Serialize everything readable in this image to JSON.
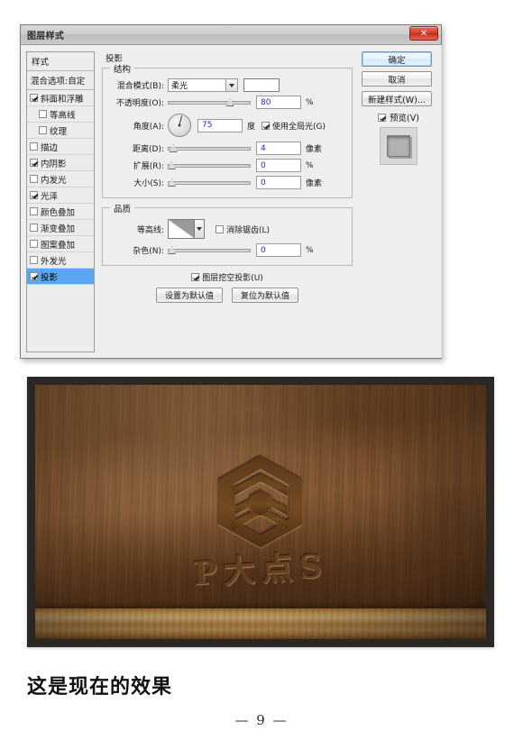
{
  "dialog": {
    "title": "图层样式",
    "close_label": "✕",
    "styles_panel": {
      "header": "样式",
      "blending_options": "混合选项:自定",
      "items": [
        {
          "label": "斜面和浮雕",
          "checked": true,
          "indent": false,
          "selected": false
        },
        {
          "label": "等高线",
          "checked": false,
          "indent": true,
          "selected": false
        },
        {
          "label": "纹理",
          "checked": false,
          "indent": true,
          "selected": false
        },
        {
          "label": "描边",
          "checked": false,
          "indent": false,
          "selected": false
        },
        {
          "label": "内阴影",
          "checked": true,
          "indent": false,
          "selected": false
        },
        {
          "label": "内发光",
          "checked": false,
          "indent": false,
          "selected": false
        },
        {
          "label": "光泽",
          "checked": true,
          "indent": false,
          "selected": false
        },
        {
          "label": "颜色叠加",
          "checked": false,
          "indent": false,
          "selected": false
        },
        {
          "label": "渐变叠加",
          "checked": false,
          "indent": false,
          "selected": false
        },
        {
          "label": "图案叠加",
          "checked": false,
          "indent": false,
          "selected": false
        },
        {
          "label": "外发光",
          "checked": false,
          "indent": false,
          "selected": false
        },
        {
          "label": "投影",
          "checked": true,
          "indent": false,
          "selected": true
        }
      ]
    },
    "drop_shadow": {
      "panel_title": "投影",
      "structure": {
        "legend": "结构",
        "blend_mode_label": "混合模式(B):",
        "blend_mode_value": "柔光",
        "color_swatch": "#ffffff",
        "opacity_label": "不透明度(O):",
        "opacity_value": "80",
        "opacity_unit": "%",
        "angle_label": "角度(A):",
        "angle_value": "75",
        "angle_unit": "度",
        "global_light_label": "使用全局光(G)",
        "global_light_checked": true,
        "distance_label": "距离(D):",
        "distance_value": "4",
        "distance_unit": "像素",
        "spread_label": "扩展(R):",
        "spread_value": "0",
        "spread_unit": "%",
        "size_label": "大小(S):",
        "size_value": "0",
        "size_unit": "像素"
      },
      "quality": {
        "legend": "品质",
        "contour_label": "等高线:",
        "antialias_label": "消除锯齿(L)",
        "antialias_checked": false,
        "noise_label": "杂色(N):",
        "noise_value": "0",
        "noise_unit": "%"
      },
      "knockout_label": "图层挖空投影(U)",
      "knockout_checked": true,
      "set_default_button": "设置为默认值",
      "reset_default_button": "复位为默认值"
    },
    "buttons": {
      "ok": "确定",
      "cancel": "取消",
      "new_style": "新建样式(W)...",
      "preview_label": "预览(V)",
      "preview_checked": true
    }
  },
  "photo": {
    "brand_text": "P大点S",
    "accent_color": "#6a4321"
  },
  "caption": "这是现在的效果",
  "page_number": "— 9 —"
}
